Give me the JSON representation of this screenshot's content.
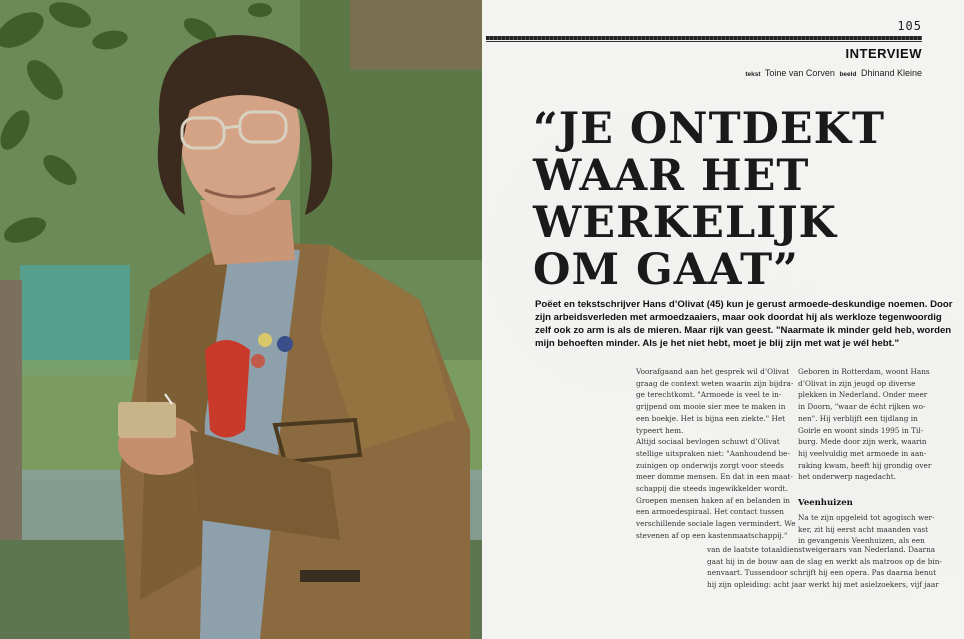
{
  "page": {
    "number": "105",
    "section": "INTERVIEW",
    "credits": {
      "text_label": "tekst",
      "text_author": "Toine van Corven",
      "image_label": "beeld",
      "image_author": "Dhinand Kleine"
    }
  },
  "article": {
    "headline_lines": [
      "“JE ONTDEKT",
      "WAAR HET",
      "WERKELIJK",
      "OM GAAT”"
    ],
    "lead_lines": [
      "Poëet en tekstschrijver Hans d’Olivat (45) kun je gerust armoede-deskundige noemen. Door",
      "zijn arbeidsverleden met armoedzaaiers, maar ook doordat hij als werkloze tegenwoordig",
      "zelf ook zo arm is als de mieren. Maar rijk van geest. \"Naarmate ik minder geld heb, worden",
      "mijn behoeften minder. Als je het niet hebt, moet je blij zijn met wat je wél hebt.\""
    ],
    "column1_lines": [
      "Voorafgaand aan het gesprek wil d’Olivat",
      "graag de context weten waarin zijn bijdra-",
      "ge terechtkomt. \"Armoede is veel te in-",
      "grijpend om mooie sier mee te maken in",
      "een boekje. Het is bijna een ziekte.\" Het",
      "typeert hem.",
      "Altijd sociaal bevlogen schuwt d’Olivat",
      "stellige uitspraken niet: \"Aanhoudend be-",
      "zuinigen op onderwijs zorgt voor steeds",
      "meer domme mensen. En dat in een maat-",
      "schappij die steeds ingewikkelder wordt.",
      "Groepen mensen haken af en belanden in",
      "een armoedespiraal. Het contact tussen",
      "verschillende sociale lagen vermindert. We",
      "stevenen af op een kastenmaatschappij.\""
    ],
    "column2_lines": [
      "Geboren in Rotterdam, woont Hans",
      "d’Olivat in zijn jeugd op diverse",
      "plekken in Nederland. Onder meer",
      "in Doorn, \"waar de écht rijken wo-",
      "nen\". Hij verblijft een tijdlang in",
      "Goirle en woont sinds 1995 in Til-",
      "burg. Mede door zijn werk, waarin",
      "hij veelvuldig met armoede in aan-",
      "raking kwam, heeft hij grondig over",
      "het onderwerp nagedacht."
    ],
    "subheading": "Veenhuizen",
    "column3_lines": [
      "Na te zijn opgeleid tot agogisch wer-",
      "ker, zit hij eerst acht maanden vast",
      "in gevangenis Veenhuizen, als een"
    ],
    "column4_lines": [
      "van de laatste totaaldienstweigeraars van Nederland. Daarna",
      "gaat hij in de bouw aan de slag en werkt als matroos op de bin-",
      "nenvaart. Tussendoor schrijft hij een opera. Pas daarna benut",
      "hij zijn opleiding: acht jaar werkt hij met asielzoekers, vijf jaar"
    ]
  },
  "colors": {
    "page_background": "#f3f3f1",
    "ink": "#1a1a1a",
    "jacket": "#8a6a3e",
    "foliage": "#4f6d3a"
  },
  "photo": {
    "subject": "portrait-of-man-with-glasses-holding-cup"
  }
}
